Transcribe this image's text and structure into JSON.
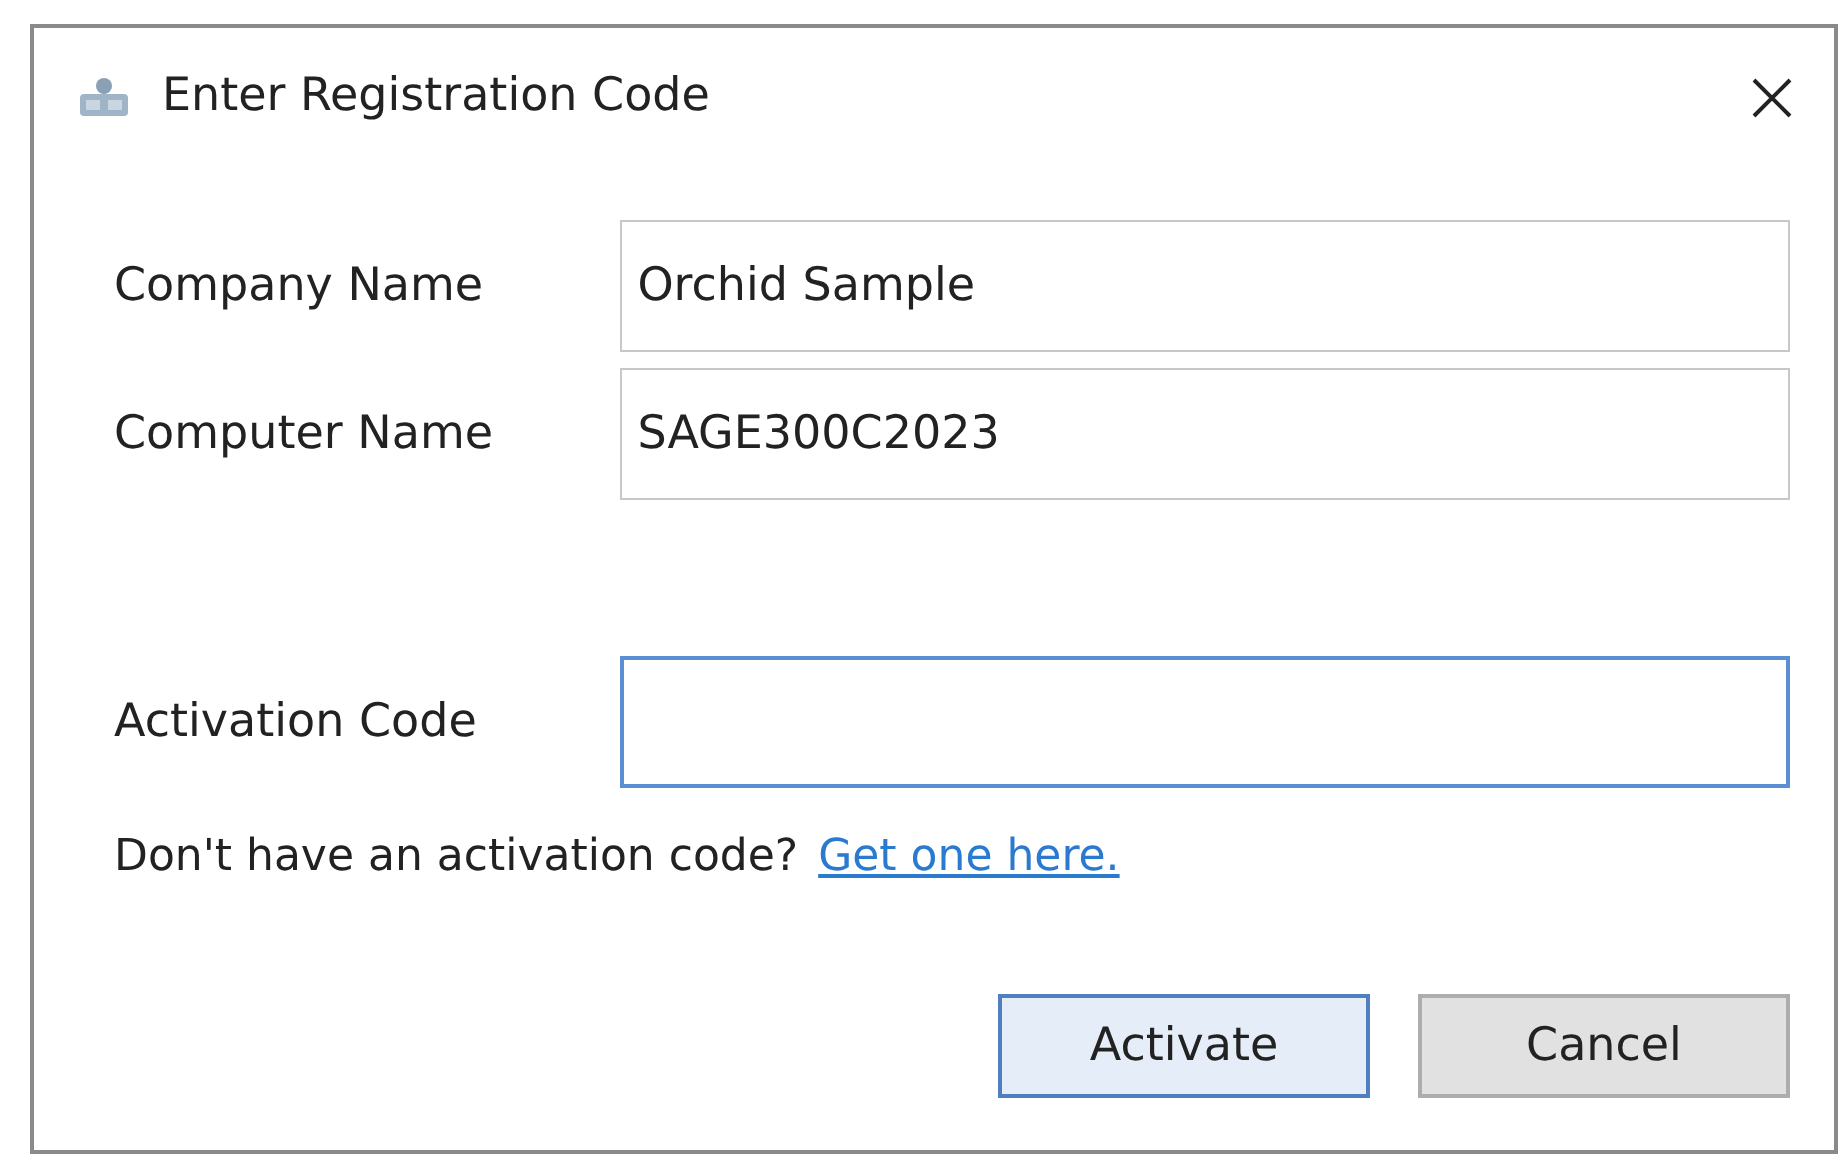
{
  "window": {
    "title": "Enter Registration Code"
  },
  "fields": [
    {
      "label": "Company Name",
      "value": "Orchid Sample",
      "focused": false
    },
    {
      "label": "Computer Name",
      "value": "SAGE300C2023",
      "focused": false
    }
  ],
  "activation_field": {
    "label": "Activation Code",
    "focused": true
  },
  "help": {
    "text": "Don't have an activation code?",
    "link": "Get one here."
  },
  "buttons": [
    {
      "label": "Activate",
      "default": true
    },
    {
      "label": "Cancel",
      "default": false
    }
  ]
}
